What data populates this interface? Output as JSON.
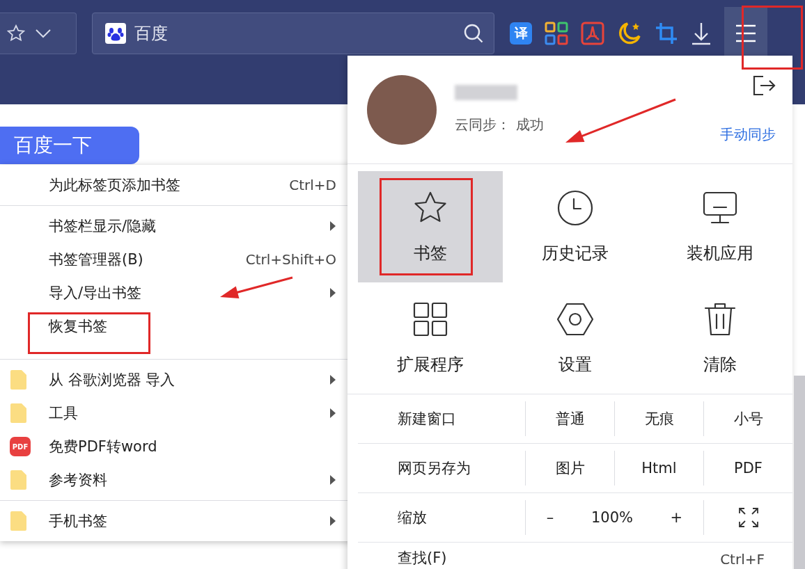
{
  "toolbar": {
    "address": {
      "text": "百度"
    },
    "translate_badge": "译",
    "menu_button": {
      "annotated": true
    }
  },
  "page": {
    "search_button": "百度一下"
  },
  "bookmark_menu": {
    "sections": [
      [
        {
          "label": "为此标签页添加书签",
          "shortcut": "Ctrl+D",
          "submenu": false,
          "kind": "plain",
          "annotated": false,
          "arrow": false
        }
      ],
      [
        {
          "label": "书签栏显示/隐藏",
          "submenu": true,
          "kind": "plain",
          "annotated": false,
          "arrow": false
        },
        {
          "label": "书签管理器(B)",
          "shortcut": "Ctrl+Shift+O",
          "submenu": false,
          "kind": "plain",
          "annotated": false,
          "arrow": false
        },
        {
          "label": "导入/导出书签",
          "submenu": true,
          "kind": "plain",
          "annotated": false,
          "arrow": true
        },
        {
          "label": "恢复书签",
          "submenu": false,
          "kind": "plain",
          "annotated": true,
          "arrow": false
        }
      ],
      [
        {
          "label": "从 谷歌浏览器 导入",
          "submenu": true,
          "kind": "folder",
          "annotated": false,
          "arrow": false
        },
        {
          "label": "工具",
          "submenu": true,
          "kind": "folder",
          "annotated": false,
          "arrow": false
        },
        {
          "label": "免费PDF转word",
          "submenu": false,
          "kind": "pdf",
          "icon_text": "PDF",
          "annotated": false,
          "arrow": false
        },
        {
          "label": "参考资料",
          "submenu": true,
          "kind": "folder",
          "annotated": false,
          "arrow": false
        }
      ],
      [
        {
          "label": "手机书签",
          "submenu": true,
          "kind": "folder",
          "annotated": false,
          "arrow": false
        }
      ]
    ]
  },
  "main_menu": {
    "profile": {
      "sync_label": "云同步：",
      "sync_status": "成功",
      "sync_button": "手动同步",
      "arrow": true
    },
    "tiles": [
      {
        "label": "书签",
        "kind": "star",
        "selected": true,
        "annotated": true
      },
      {
        "label": "历史记录",
        "kind": "clock",
        "selected": false,
        "annotated": false
      },
      {
        "label": "装机应用",
        "kind": "monitor",
        "selected": false,
        "annotated": false
      },
      {
        "label": "扩展程序",
        "kind": "grid",
        "selected": false,
        "annotated": false
      },
      {
        "label": "设置",
        "kind": "hexagon",
        "selected": false,
        "annotated": false
      },
      {
        "label": "清除",
        "kind": "trash",
        "selected": false,
        "annotated": false
      }
    ],
    "rows": [
      {
        "kind": "options",
        "label": "新建窗口",
        "options": [
          "普通",
          "无痕",
          "小号"
        ]
      },
      {
        "kind": "options",
        "label": "网页另存为",
        "options": [
          "图片",
          "Html",
          "PDF"
        ]
      },
      {
        "kind": "zoom",
        "label": "缩放",
        "minus": "–",
        "value": "100%",
        "plus": "+"
      },
      {
        "kind": "shortcut",
        "label": "查找(F)",
        "shortcut": "Ctrl+F"
      }
    ]
  }
}
